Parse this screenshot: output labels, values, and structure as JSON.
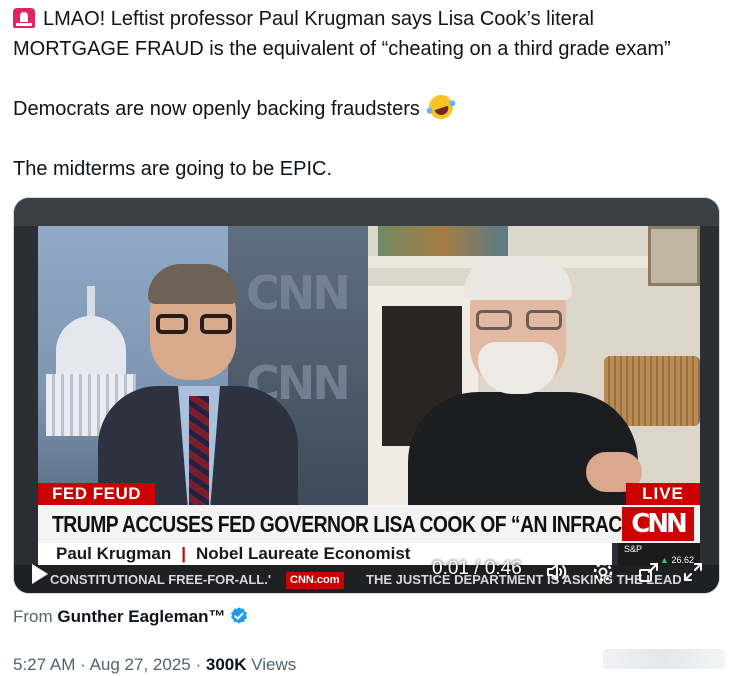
{
  "tweet": {
    "line1": "LMAO! Leftist professor Paul Krugman says Lisa Cook’s literal",
    "line2": "MORTGAGE FRAUD is the equivalent of “cheating on a third grade exam”",
    "line3": "Democrats are now openly backing fraudsters",
    "line4": "The midterms are going to be EPIC.",
    "lead_icon": "siren-emoji",
    "trail_icon": "rolling-on-floor-laughing-emoji"
  },
  "video": {
    "cnn_wall_text": "CNN",
    "badge_left": "FED FEUD",
    "badge_live": "LIVE",
    "headline": "TRUMP ACCUSES FED GOVERNOR LISA COOK OF “AN INFRACTION”",
    "logo": "CNN",
    "guest_name": "Paul Krugman",
    "name_separator": "|",
    "guest_title": "Nobel Laureate Economist",
    "market_label": "S&P",
    "market_value": "26.62",
    "ticker_left": "CONSTITUTIONAL FREE-FOR-ALL.'",
    "ticker_logo": "CNN.com",
    "ticker_right": "THE JUSTICE DEPARTMENT IS ASKING THE LEAD",
    "time": "0:01 / 0:46",
    "icons": [
      "play-icon",
      "volume-icon",
      "settings-icon",
      "exit-fullscreen-icon",
      "expand-icon"
    ]
  },
  "source": {
    "prefix": "From",
    "name": "Gunther Eagleman™",
    "verified_color": "#1d9bf0"
  },
  "meta": {
    "time": "5:27 AM",
    "dot1": "·",
    "date": "Aug 27, 2025",
    "dot2": "·",
    "views_count": "300K",
    "views_label": "Views"
  },
  "colors": {
    "text": "#0f1419",
    "secondary": "#536471",
    "cnn_red": "#cc0000"
  }
}
